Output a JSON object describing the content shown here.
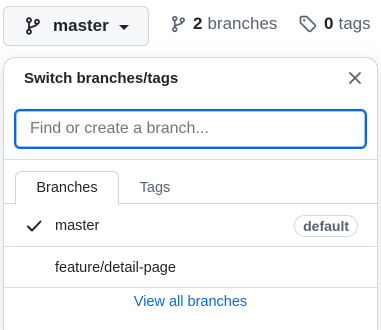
{
  "topbar": {
    "branch_button": {
      "label": "master",
      "icon": "git-branch-icon"
    },
    "branches_stat": {
      "count": "2",
      "label": "branches",
      "icon": "git-branch-icon"
    },
    "tags_stat": {
      "count": "0",
      "label": "tags",
      "icon": "tag-icon"
    }
  },
  "panel": {
    "title": "Switch branches/tags",
    "close_icon": "close-icon",
    "search": {
      "placeholder": "Find or create a branch...",
      "value": ""
    },
    "tabs": [
      {
        "label": "Branches",
        "selected": true
      },
      {
        "label": "Tags",
        "selected": false
      }
    ],
    "branches": [
      {
        "name": "master",
        "checked": true,
        "badge": "default"
      },
      {
        "name": "feature/detail-page",
        "checked": false,
        "badge": ""
      }
    ],
    "view_all": "View all branches"
  },
  "colors": {
    "accent": "#0969da",
    "text": "#1f2328",
    "muted": "#59636e",
    "border": "#d0d7de"
  }
}
